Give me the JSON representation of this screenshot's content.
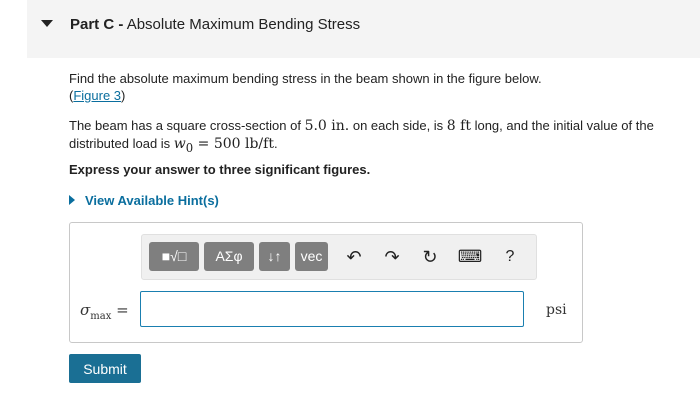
{
  "part": {
    "label": "Part C -",
    "title": "Absolute Maximum Bending Stress"
  },
  "question": {
    "line1": "Find the absolute maximum bending stress in the beam shown in the figure below.",
    "figure_link": "Figure 3",
    "beam_text_a": "The beam has a square cross-section of ",
    "side_value": "5.0 in.",
    "beam_text_b": " on each side, is ",
    "length_value": "8 ft",
    "beam_text_c": " long, and the initial value of the distributed load is ",
    "w0_sym": "w",
    "w0_sub": "0",
    "w0_value": " = 500 lb/ft",
    "beam_text_d": ".",
    "instruction": "Express your answer to three significant figures."
  },
  "hint": {
    "label": "View Available Hint(s)"
  },
  "toolbar": {
    "templates": "■√□",
    "greek": "ΑΣφ",
    "arrows": "↓↑",
    "vec": "vec",
    "undo": "↶",
    "redo": "↷",
    "reset": "↻",
    "keyboard": "⌨",
    "help": "?"
  },
  "answer": {
    "symbol": "σ",
    "subscript": "max",
    "equals": " =",
    "value": "",
    "unit": "psi"
  },
  "submit_label": "Submit"
}
